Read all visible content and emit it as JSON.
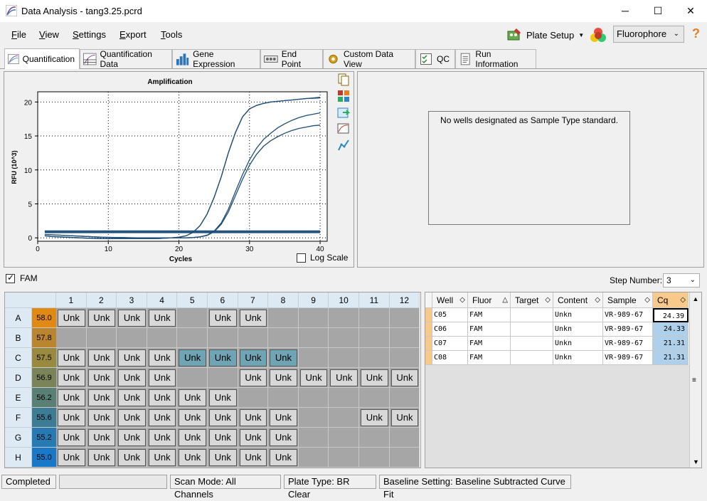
{
  "window": {
    "title": "Data Analysis - tang3.25.pcrd",
    "minimize": "─",
    "maximize": "☐",
    "close": "✕"
  },
  "menu": [
    "File",
    "View",
    "Settings",
    "Export",
    "Tools"
  ],
  "toolbar": {
    "plate_setup": "Plate Setup",
    "fluorophore": "Fluorophore",
    "help": "?"
  },
  "tabs": [
    "Quantification",
    "Quantification Data",
    "Gene Expression",
    "End Point",
    "Custom Data View",
    "QC",
    "Run Information"
  ],
  "chart_data": {
    "type": "line",
    "title": "Amplification",
    "xlabel": "Cycles",
    "ylabel": "RFU (10^3)",
    "xlim": [
      0,
      41
    ],
    "ylim": [
      -0.5,
      21.5
    ],
    "xticks": [
      0,
      10,
      20,
      30,
      40
    ],
    "yticks": [
      0,
      5,
      10,
      15,
      20
    ],
    "grid": true,
    "x": [
      1,
      2,
      3,
      4,
      5,
      6,
      7,
      8,
      9,
      10,
      11,
      12,
      13,
      14,
      15,
      16,
      17,
      18,
      19,
      20,
      21,
      22,
      23,
      24,
      25,
      26,
      27,
      28,
      29,
      30,
      31,
      32,
      33,
      34,
      35,
      36,
      37,
      38,
      39,
      40
    ],
    "series": [
      {
        "values": [
          0.3,
          0.2,
          0.15,
          0.1,
          0.05,
          0,
          -0.05,
          -0.08,
          -0.1,
          -0.1,
          -0.1,
          -0.1,
          -0.1,
          -0.1,
          -0.1,
          -0.1,
          -0.1,
          -0.05,
          0,
          0.1,
          0.3,
          0.8,
          1.8,
          3.5,
          6.0,
          9.0,
          12.5,
          15.5,
          17.8,
          19.0,
          19.5,
          19.8,
          20.0,
          20.1,
          20.2,
          20.3,
          20.4,
          20.5,
          20.6,
          20.7
        ]
      },
      {
        "values": [
          0.3,
          0.2,
          0.15,
          0.1,
          0.05,
          0,
          -0.05,
          -0.08,
          -0.1,
          -0.1,
          -0.1,
          -0.1,
          -0.1,
          -0.1,
          -0.1,
          -0.1,
          -0.1,
          -0.05,
          0,
          0.1,
          0.3,
          0.8,
          1.8,
          3.5,
          6.0,
          9.0,
          12.5,
          15.5,
          17.8,
          19.0,
          19.5,
          19.8,
          20.0,
          20.1,
          20.2,
          20.3,
          20.4,
          20.5,
          20.55,
          20.6
        ]
      },
      {
        "values": [
          0.5,
          0.45,
          0.4,
          0.35,
          0.3,
          0.25,
          0.2,
          0.15,
          0.1,
          0.08,
          0.06,
          0.04,
          0.02,
          0,
          0,
          0,
          0,
          0,
          0,
          0,
          0,
          0.05,
          0.15,
          0.4,
          1.0,
          2.2,
          4.2,
          6.8,
          9.3,
          11.5,
          13.2,
          14.5,
          15.4,
          16.2,
          16.8,
          17.3,
          17.7,
          18.0,
          18.2,
          18.4
        ]
      },
      {
        "values": [
          0.5,
          0.45,
          0.4,
          0.35,
          0.3,
          0.25,
          0.2,
          0.15,
          0.1,
          0.08,
          0.06,
          0.04,
          0.02,
          0,
          0,
          0,
          0,
          0,
          0,
          0,
          0,
          0.05,
          0.15,
          0.35,
          0.9,
          2.0,
          3.8,
          6.2,
          8.6,
          10.7,
          12.3,
          13.5,
          14.3,
          14.9,
          15.4,
          15.8,
          16.1,
          16.3,
          16.5,
          16.6
        ]
      },
      {
        "values": [
          0.8,
          0.8,
          0.8,
          0.8,
          0.8,
          0.8,
          0.8,
          0.8,
          0.8,
          0.8,
          0.8,
          0.8,
          0.8,
          0.8,
          0.8,
          0.8,
          0.8,
          0.8,
          0.8,
          0.8,
          0.8,
          0.8,
          0.8,
          0.8,
          0.8,
          0.8,
          0.8,
          0.8,
          0.8,
          0.8,
          0.8,
          0.8,
          0.8,
          0.8,
          0.8,
          0.8,
          0.8,
          0.8,
          0.8,
          0.8
        ]
      },
      {
        "values": [
          1.0,
          1.0,
          1.0,
          1.0,
          1.0,
          1.0,
          1.0,
          1.0,
          1.0,
          1.0,
          1.0,
          1.0,
          1.0,
          1.0,
          1.0,
          1.0,
          1.0,
          1.0,
          1.0,
          1.0,
          1.0,
          1.0,
          1.0,
          1.0,
          1.0,
          1.0,
          1.0,
          1.0,
          1.0,
          1.0,
          1.0,
          1.0,
          1.0,
          1.0,
          1.0,
          1.0,
          1.0,
          1.0,
          1.0,
          1.0
        ]
      }
    ]
  },
  "chart_colors": {
    "line": "#1f4e79",
    "plot_bg": "#ffffff"
  },
  "log_scale_label": "Log Scale",
  "std_message": "No wells designated as Sample Type standard.",
  "fam_label": "FAM",
  "step_number": {
    "label": "Step Number:",
    "value": "3"
  },
  "plate": {
    "cols": [
      "1",
      "2",
      "3",
      "4",
      "5",
      "6",
      "7",
      "8",
      "9",
      "10",
      "11",
      "12"
    ],
    "rows": [
      {
        "label": "A",
        "temp": "58.0",
        "color": "#e08a14",
        "wells": [
          "Unk",
          "Unk",
          "Unk",
          "Unk",
          "",
          "Unk",
          "Unk",
          "",
          "",
          "",
          "",
          ""
        ]
      },
      {
        "label": "B",
        "temp": "57.8",
        "color": "#b9852e",
        "wells": [
          "",
          "",
          "",
          "",
          "",
          "",
          "",
          "",
          "",
          "",
          "",
          ""
        ]
      },
      {
        "label": "C",
        "temp": "57.5",
        "color": "#998a3f",
        "wells": [
          "Unk",
          "Unk",
          "Unk",
          "Unk",
          "Unk",
          "Unk",
          "Unk",
          "Unk",
          "",
          "",
          "",
          ""
        ],
        "selected": [
          4,
          5,
          6,
          7
        ]
      },
      {
        "label": "D",
        "temp": "56.9",
        "color": "#7b8458",
        "wells": [
          "Unk",
          "Unk",
          "Unk",
          "Unk",
          "",
          "",
          "Unk",
          "Unk",
          "Unk",
          "Unk",
          "Unk",
          "Unk"
        ]
      },
      {
        "label": "E",
        "temp": "56.2",
        "color": "#5a7f74",
        "wells": [
          "Unk",
          "Unk",
          "Unk",
          "Unk",
          "Unk",
          "Unk",
          "",
          "",
          "",
          "",
          "",
          ""
        ]
      },
      {
        "label": "F",
        "temp": "55.6",
        "color": "#3d7c95",
        "wells": [
          "Unk",
          "Unk",
          "Unk",
          "Unk",
          "Unk",
          "Unk",
          "Unk",
          "Unk",
          "",
          "",
          "Unk",
          "Unk"
        ]
      },
      {
        "label": "G",
        "temp": "55.2",
        "color": "#277ab2",
        "wells": [
          "Unk",
          "Unk",
          "Unk",
          "Unk",
          "Unk",
          "Unk",
          "Unk",
          "Unk",
          "",
          "",
          "",
          ""
        ]
      },
      {
        "label": "H",
        "temp": "55.0",
        "color": "#1a78c8",
        "wells": [
          "Unk",
          "Unk",
          "Unk",
          "Unk",
          "Unk",
          "Unk",
          "Unk",
          "Unk",
          "",
          "",
          "",
          ""
        ]
      }
    ]
  },
  "table": {
    "headers": [
      "Well",
      "Fluor",
      "Target",
      "Content",
      "Sample",
      "Cq"
    ],
    "rows": [
      [
        "C05",
        "FAM",
        "",
        "Unkn",
        "VR-989-67",
        "24.39"
      ],
      [
        "C06",
        "FAM",
        "",
        "Unkn",
        "VR-989-67",
        "24.33"
      ],
      [
        "C07",
        "FAM",
        "",
        "Unkn",
        "VR-989-67",
        "21.31"
      ],
      [
        "C08",
        "FAM",
        "",
        "Unkn",
        "VR-989-67",
        "21.31"
      ]
    ]
  },
  "status": {
    "state": "Completed",
    "scan_mode": "Scan Mode: All Channels",
    "plate_type": "Plate Type: BR Clear",
    "baseline": "Baseline Setting: Baseline Subtracted Curve Fit"
  }
}
